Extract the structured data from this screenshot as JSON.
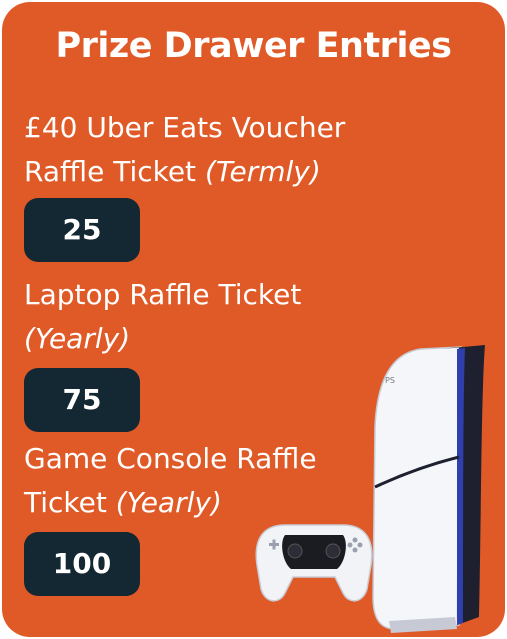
{
  "title": "Prize Drawer Entries",
  "prizes": [
    {
      "line1": "£40 Uber Eats Voucher",
      "line2_text": "Raffle Ticket ",
      "line2_note": "(Termly)",
      "count": "25"
    },
    {
      "line1": "Laptop Raffle Ticket",
      "line2_text": "",
      "line2_note": "(Yearly)",
      "count": "75"
    },
    {
      "line1": "Game Console Raffle",
      "line2_text": "Ticket ",
      "line2_note": "(Yearly)",
      "count": "100"
    }
  ],
  "colors": {
    "card_background": "#e05a27",
    "badge_background": "#142833",
    "text": "#ffffff"
  },
  "images": [
    "game-console",
    "game-controller"
  ]
}
